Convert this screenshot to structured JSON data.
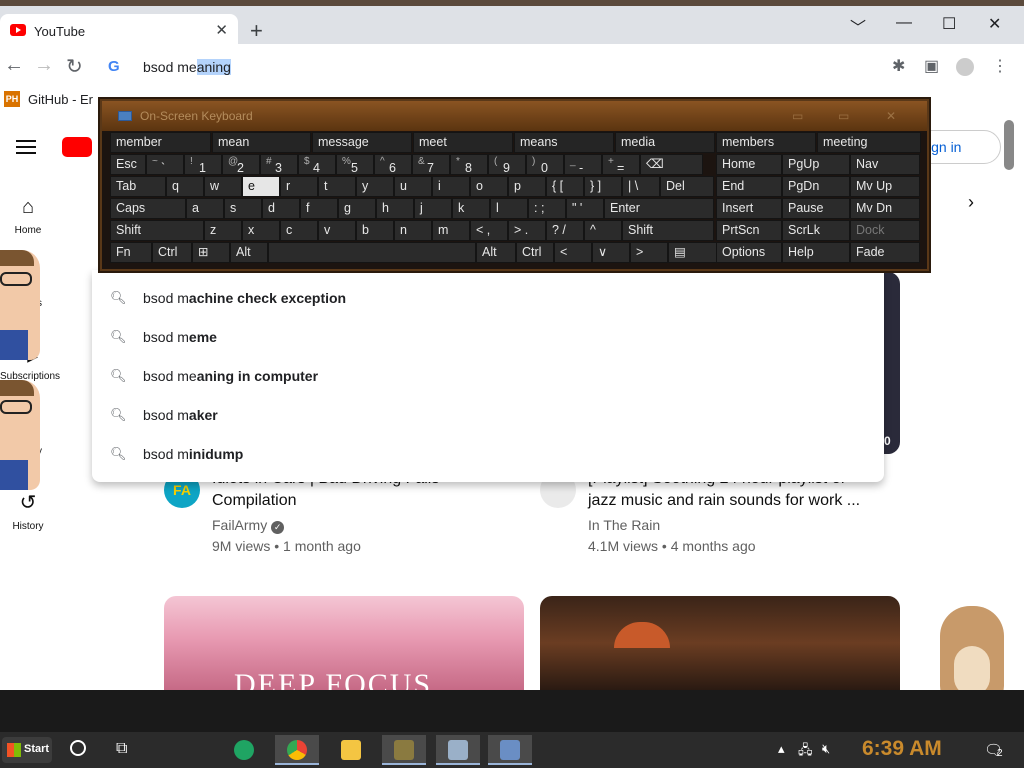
{
  "browser": {
    "tab_title": "YouTube",
    "tab_close": "✕",
    "new_tab": "+",
    "win_min": "﹀",
    "win_min2": "—",
    "win_max": "☐",
    "win_close": "✕",
    "omnibox_text_prefix": "bsod me",
    "omnibox_text_selected": "aning",
    "bookmark_label": "GitHub - Er",
    "bookmark_icon_text": "PH",
    "google_letter": "G"
  },
  "youtube": {
    "sidebar": [
      {
        "label": "Home",
        "icon": "home-icon"
      },
      {
        "label": "rts",
        "icon": "shorts-icon"
      },
      {
        "label": "Subscriptions",
        "icon": "subscriptions-icon"
      },
      {
        "label": "rary",
        "icon": "library-icon"
      },
      {
        "label": "History",
        "icon": "history-icon"
      }
    ],
    "sign_in": "ign in",
    "cards": [
      {
        "title1": "Idiots in Cars | Bad Driving Fails",
        "title2": "Compilation",
        "channel": "FailArmy",
        "meta": "9M views • 1 month ago",
        "avatar": "FA"
      },
      {
        "title1": "[Playlist] Soothing 24 hour playlist of",
        "title2": "jazz music and rain sounds for work ...",
        "channel": "In The Rain",
        "meta": "4.1M views • 4 months ago"
      }
    ],
    "thumb_text": "DEEP FOCUS",
    "corner_badge": "0"
  },
  "suggestions": [
    {
      "prefix": "bsod m",
      "rest": "achine check exception"
    },
    {
      "prefix": "bsod m",
      "rest": "eme"
    },
    {
      "prefix": "bsod me",
      "rest": "aning in computer"
    },
    {
      "prefix": "bsod m",
      "rest": "aker"
    },
    {
      "prefix": "bsod m",
      "rest": "inidump"
    }
  ],
  "osk": {
    "title": "On-Screen Keyboard",
    "predictions": [
      "member",
      "mean",
      "message",
      "meet",
      "means",
      "media",
      "members",
      "meeting"
    ],
    "row1": [
      {
        "l": "Esc"
      },
      {
        "s": "~",
        "m": "`"
      },
      {
        "s": "!",
        "m": "1"
      },
      {
        "s": "@",
        "m": "2"
      },
      {
        "s": "#",
        "m": "3"
      },
      {
        "s": "$",
        "m": "4"
      },
      {
        "s": "%",
        "m": "5"
      },
      {
        "s": "^",
        "m": "6"
      },
      {
        "s": "&",
        "m": "7"
      },
      {
        "s": "*",
        "m": "8"
      },
      {
        "s": "(",
        "m": "9"
      },
      {
        "s": ")",
        "m": "0"
      },
      {
        "s": "_",
        "m": "-"
      },
      {
        "s": "+",
        "m": "="
      },
      {
        "l": "⌫"
      }
    ],
    "row2": [
      "Tab",
      "q",
      "w",
      "e",
      "r",
      "t",
      "y",
      "u",
      "i",
      "o",
      "p",
      "{ [",
      "} ]",
      "| \\",
      "Del"
    ],
    "row3": [
      "Caps",
      "a",
      "s",
      "d",
      "f",
      "g",
      "h",
      "j",
      "k",
      "l",
      ": ;",
      "\" '",
      "Enter"
    ],
    "row4": [
      "Shift",
      "z",
      "x",
      "c",
      "v",
      "b",
      "n",
      "m",
      "< ,",
      "> .",
      "? /",
      "^",
      "Shift"
    ],
    "row5": [
      "Fn",
      "Ctrl",
      "⊞",
      "Alt",
      "",
      "Alt",
      "Ctrl",
      "<",
      "∨",
      ">",
      "▤"
    ],
    "nav": [
      [
        "Home",
        "PgUp",
        "Nav"
      ],
      [
        "End",
        "PgDn",
        "Mv Up"
      ],
      [
        "Insert",
        "Pause",
        "Mv Dn"
      ],
      [
        "PrtScn",
        "ScrLk",
        "Dock"
      ],
      [
        "Options",
        "Help",
        "Fade"
      ]
    ]
  },
  "taskbar": {
    "start": "Start",
    "clock": "6:39 AM",
    "notif_count": "2"
  }
}
